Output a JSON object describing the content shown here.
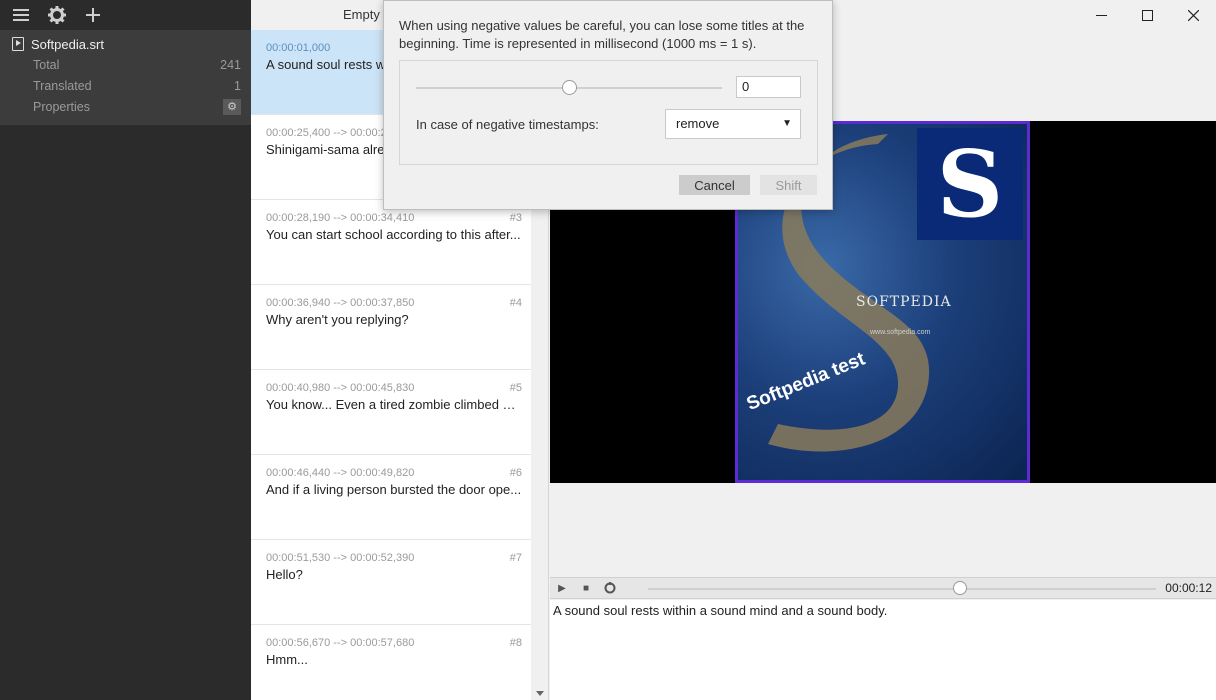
{
  "toolbar": {
    "menu_icon": "menu-icon",
    "settings_icon": "gear-icon",
    "add_icon": "plus-icon"
  },
  "sidebar": {
    "file_name": "Softpedia.srt",
    "stats": [
      {
        "label": "Total",
        "value": "241"
      },
      {
        "label": "Translated",
        "value": "1"
      },
      {
        "label": "Properties",
        "value": ""
      }
    ]
  },
  "list": {
    "header": "Empty",
    "items": [
      {
        "time": "00:00:01,000",
        "num": "",
        "text": "A sound soul rests w"
      },
      {
        "time": "00:00:25,400 --> 00:00:2",
        "num": "",
        "text": "Shinigami-sama alre"
      },
      {
        "time": "00:00:28,190 --> 00:00:34,410",
        "num": "#3",
        "text": "You can start school according to this after..."
      },
      {
        "time": "00:00:36,940 --> 00:00:37,850",
        "num": "#4",
        "text": "Why aren't you replying?"
      },
      {
        "time": "00:00:40,980 --> 00:00:45,830",
        "num": "#5",
        "text": "You know... Even a tired zombie climbed ou..."
      },
      {
        "time": "00:00:46,440 --> 00:00:49,820",
        "num": "#6",
        "text": "And if a living person bursted the door ope..."
      },
      {
        "time": "00:00:51,530 --> 00:00:52,390",
        "num": "#7",
        "text": "Hello?"
      },
      {
        "time": "00:00:56,670 --> 00:00:57,680",
        "num": "#8",
        "text": "Hmm..."
      }
    ]
  },
  "dialog": {
    "warning": "When using negative values be careful, you can lose some titles at the beginning. Time is represented in millisecond (1000 ms = 1 s).",
    "offset_value": "0",
    "negative_label": "In case of negative timestamps:",
    "negative_option": "remove",
    "cancel_label": "Cancel",
    "shift_label": "Shift"
  },
  "poster": {
    "logo_letter": "S",
    "brand": "SOFTPEDIA",
    "url": "www.softpedia.com",
    "caption": "Softpedia test"
  },
  "player": {
    "time": "00:00:12",
    "position": 0.6
  },
  "subtitle_text": "A sound soul rests within a sound mind and a sound body.",
  "colors": {
    "sidebar": "#2b2b2b",
    "selected": "#cce4f7",
    "poster_border": "#5b2bd6"
  }
}
